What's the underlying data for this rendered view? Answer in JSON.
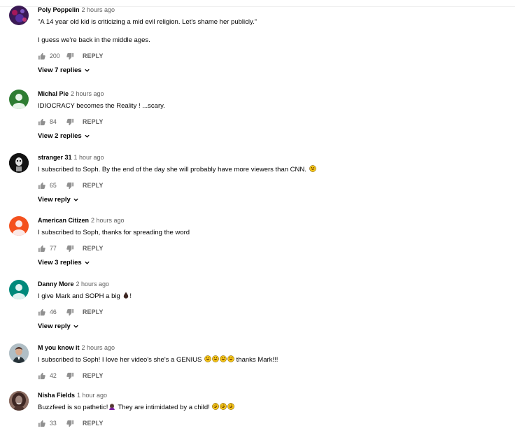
{
  "comments": [
    {
      "author": "Poly Poppelin",
      "time": "2 hours ago",
      "text": "\"A 14 year old kid is criticizing a mid evil religion. Let's shame her publicly.\"\n\nI guess we're back in the middle ages.",
      "likes": "200",
      "reply_label": "REPLY",
      "view_replies": "View 7 replies",
      "avatar_icon": "purple-photo-avatar"
    },
    {
      "author": "Michal Pie",
      "time": "2 hours ago",
      "text": "IDIOCRACY becomes  the Reality ! ...scary.",
      "likes": "84",
      "reply_label": "REPLY",
      "view_replies": "View 2 replies",
      "avatar_icon": "green-default-avatar"
    },
    {
      "author": "stranger 31",
      "time": "1 hour ago",
      "text": "I subscribed to Soph. By the end of the day she will probably have more viewers than CNN.",
      "likes": "65",
      "reply_label": "REPLY",
      "view_replies": "View reply",
      "avatar_icon": "dark-masked-avatar",
      "emoji_count": 1
    },
    {
      "author": "American Citizen",
      "time": "2 hours ago",
      "text": "I subscribed to Soph, thanks for spreading the word",
      "likes": "77",
      "reply_label": "REPLY",
      "view_replies": "View 3 replies",
      "avatar_icon": "orange-default-avatar"
    },
    {
      "author": "Danny More",
      "time": "2 hours ago",
      "text_before": "I give Mark and SOPH a big",
      "text_after": "!",
      "likes": "46",
      "reply_label": "REPLY",
      "view_replies": "View reply",
      "avatar_icon": "teal-default-avatar"
    },
    {
      "author": "M you know it",
      "time": "2 hours ago",
      "text_before": "I subscribed to Soph! I love her video's she's a GENIUS",
      "text_after": "thanks Mark!!!",
      "likes": "42",
      "reply_label": "REPLY",
      "avatar_icon": "man-photo-avatar"
    },
    {
      "author": "Nisha Fields",
      "time": "1 hour ago",
      "text_before": "Buzzfeed is so pathetic!",
      "text_middle": "They are intimidated by a child!",
      "likes": "33",
      "reply_label": "REPLY",
      "avatar_icon": "woman-photo-avatar"
    }
  ],
  "colors": {
    "author": "#030303",
    "meta": "#606060",
    "avatar_green": "#2e7d32",
    "avatar_orange": "#f4511e",
    "avatar_teal": "#00897b"
  }
}
